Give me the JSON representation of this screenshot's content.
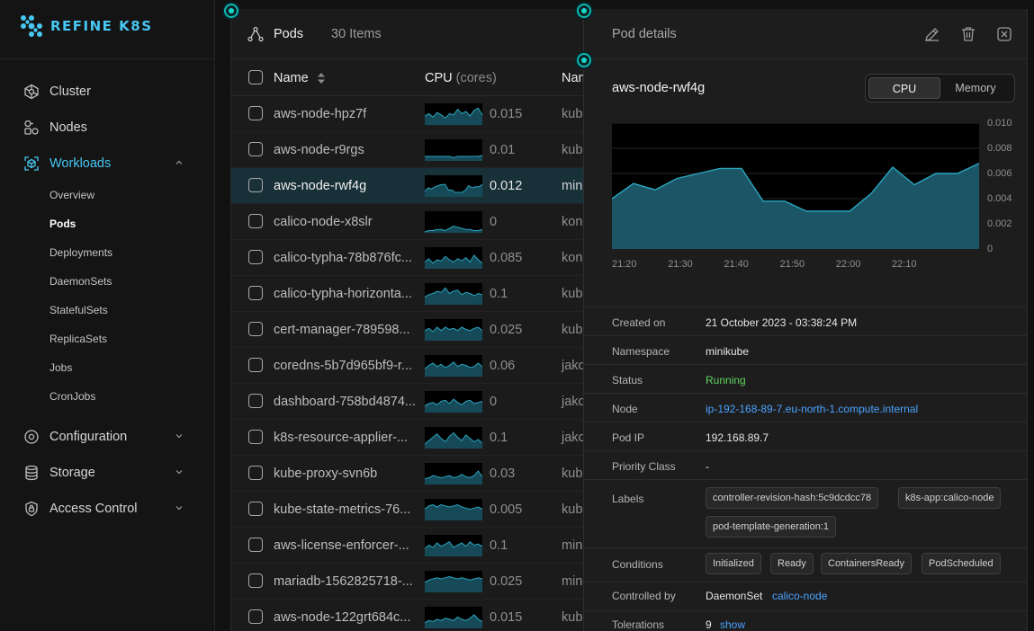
{
  "app": {
    "name": "REFINE K8S",
    "accent": "#47c7f2"
  },
  "sidebar": {
    "items": [
      {
        "label": "Cluster",
        "icon": "cluster-icon"
      },
      {
        "label": "Nodes",
        "icon": "nodes-icon"
      },
      {
        "label": "Workloads",
        "icon": "workloads-icon",
        "expanded": true
      },
      {
        "label": "Configuration",
        "icon": "gear-icon"
      },
      {
        "label": "Storage",
        "icon": "database-icon"
      },
      {
        "label": "Access Control",
        "icon": "shield-lock-icon"
      }
    ],
    "workloads_sub": [
      "Overview",
      "Pods",
      "Deployments",
      "DaemonSets",
      "StatefulSets",
      "ReplicaSets",
      "Jobs",
      "CronJobs"
    ],
    "active_sub": "Pods"
  },
  "list": {
    "title": "Pods",
    "count": "30 Items",
    "columns": {
      "name": "Name",
      "cpu": "CPU",
      "cpu_unit": "(cores)",
      "namespace": "Nam"
    },
    "rows": [
      {
        "name": "aws-node-hpz7f",
        "cpu": "0.015",
        "ns": "kub",
        "spark": [
          8,
          10,
          7,
          11,
          9,
          6,
          10,
          9,
          14,
          10,
          12,
          8,
          13,
          15,
          9
        ]
      },
      {
        "name": "aws-node-r9rgs",
        "cpu": "0.01",
        "ns": "kub",
        "spark": [
          4,
          4,
          4,
          4,
          4,
          4,
          4,
          3,
          4,
          4,
          4,
          4,
          4,
          4,
          5
        ]
      },
      {
        "name": "aws-node-rwf4g",
        "cpu": "0.012",
        "ns": "min",
        "spark": [
          5,
          8,
          7,
          9,
          10,
          11,
          11,
          6,
          6,
          4,
          4,
          4,
          6,
          10,
          8,
          9,
          9,
          11
        ],
        "selected": true
      },
      {
        "name": "calico-node-x8slr",
        "cpu": "0",
        "ns": "kon",
        "spark": [
          1,
          2,
          2,
          3,
          3,
          2,
          4,
          6,
          5,
          4,
          3,
          3,
          2,
          2,
          3
        ]
      },
      {
        "name": "calico-typha-78b876fc...",
        "cpu": "0.085",
        "ns": "kon",
        "spark": [
          6,
          9,
          5,
          8,
          7,
          11,
          8,
          6,
          9,
          7,
          10,
          6,
          12,
          8,
          5
        ]
      },
      {
        "name": "calico-typha-horizonta...",
        "cpu": "0.1",
        "ns": "kub",
        "spark": [
          7,
          9,
          10,
          12,
          11,
          15,
          10,
          12,
          13,
          9,
          11,
          10,
          8,
          10,
          9
        ]
      },
      {
        "name": "cert-manager-789598...",
        "cpu": "0.025",
        "ns": "kub",
        "spark": [
          9,
          11,
          8,
          12,
          9,
          12,
          10,
          11,
          9,
          12,
          10,
          9,
          11,
          12,
          9
        ]
      },
      {
        "name": "coredns-5b7d965bf9-r...",
        "cpu": "0.06",
        "ns": "jako",
        "spark": [
          7,
          10,
          12,
          9,
          11,
          8,
          10,
          13,
          9,
          11,
          10,
          8,
          9,
          12,
          9
        ]
      },
      {
        "name": "dashboard-758bd4874...",
        "cpu": "0",
        "ns": "jako",
        "spark": [
          6,
          8,
          9,
          7,
          10,
          11,
          8,
          12,
          9,
          7,
          10,
          11,
          8,
          9,
          10
        ]
      },
      {
        "name": "k8s-resource-applier-...",
        "cpu": "0.1",
        "ns": "jako",
        "spark": [
          4,
          7,
          10,
          13,
          9,
          6,
          11,
          14,
          10,
          7,
          12,
          9,
          6,
          8,
          5
        ]
      },
      {
        "name": "kube-proxy-svn6b",
        "cpu": "0.03",
        "ns": "kub",
        "spark": [
          5,
          6,
          8,
          7,
          6,
          7,
          8,
          6,
          7,
          9,
          7,
          6,
          8,
          12,
          7
        ]
      },
      {
        "name": "kube-state-metrics-76...",
        "cpu": "0.005",
        "ns": "kub",
        "spark": [
          10,
          13,
          14,
          12,
          14,
          13,
          12,
          13,
          14,
          12,
          11,
          10,
          11,
          12,
          10
        ]
      },
      {
        "name": "aws-license-enforcer-...",
        "cpu": "0.1",
        "ns": "min",
        "spark": [
          7,
          10,
          8,
          12,
          9,
          11,
          13,
          8,
          10,
          12,
          9,
          13,
          10,
          11,
          9
        ]
      },
      {
        "name": "mariadb-1562825718-...",
        "cpu": "0.025",
        "ns": "min",
        "spark": [
          9,
          11,
          12,
          13,
          12,
          13,
          14,
          13,
          12,
          13,
          12,
          11,
          12,
          13,
          12
        ]
      },
      {
        "name": "aws-node-122grt684c...",
        "cpu": "0.015",
        "ns": "kub",
        "spark": [
          5,
          7,
          6,
          8,
          7,
          9,
          8,
          7,
          10,
          8,
          7,
          9,
          12,
          8,
          6
        ]
      }
    ]
  },
  "detail": {
    "title": "Pod details",
    "pod_name": "aws-node-rwf4g",
    "seg": {
      "cpu": "CPU",
      "memory": "Memory",
      "active": "CPU"
    },
    "fields": {
      "created_on": {
        "key": "Created on",
        "value": "21 October 2023 - 03:38:24 PM"
      },
      "namespace": {
        "key": "Namespace",
        "value": "minikube"
      },
      "status": {
        "key": "Status",
        "value": "Running"
      },
      "node": {
        "key": "Node",
        "value": "ip-192-168-89-7.eu-north-1.compute.internal"
      },
      "pod_ip": {
        "key": "Pod IP",
        "value": "192.168.89.7"
      },
      "priority": {
        "key": "Priority Class",
        "value": "-"
      },
      "labels": {
        "key": "Labels",
        "values": [
          "controller-revision-hash:5c9dcdcc78",
          "k8s-app:calico-node",
          "pod-template-generation:1"
        ]
      },
      "conditions": {
        "key": "Conditions",
        "values": [
          "Initialized",
          "Ready",
          "ContainersReady",
          "PodScheduled"
        ]
      },
      "controlled_by": {
        "key": "Controlled by",
        "kind": "DaemonSet",
        "name": "calico-node"
      },
      "tolerations": {
        "key": "Tolerations",
        "count": "9",
        "action": "show"
      }
    },
    "colors": {
      "status_running": "#5fd35f",
      "link": "#4aa3ff",
      "chart_line": "#2aa6bf",
      "chart_fill": "#1c5566"
    }
  },
  "chart_data": {
    "type": "area",
    "title": "",
    "x": [
      "21:20",
      "21:25",
      "21:30",
      "21:35",
      "21:40",
      "21:45",
      "21:50",
      "21:55",
      "22:00",
      "22:05",
      "22:10",
      "22:15",
      "22:20"
    ],
    "x_ticks": [
      "21:20",
      "21:30",
      "21:40",
      "21:50",
      "22:00",
      "22:10"
    ],
    "y_ticks": [
      "0.010",
      "0.008",
      "0.006",
      "0.004",
      "0.002",
      "0"
    ],
    "ylim": [
      0,
      0.01
    ],
    "series": [
      {
        "values": [
          0.004,
          0.0052,
          0.0047,
          0.0056,
          0.006,
          0.0064,
          0.0064,
          0.0038,
          0.0038,
          0.003,
          0.003,
          0.003,
          0.0044,
          0.0065,
          0.0051,
          0.006,
          0.006,
          0.0068
        ]
      }
    ]
  }
}
